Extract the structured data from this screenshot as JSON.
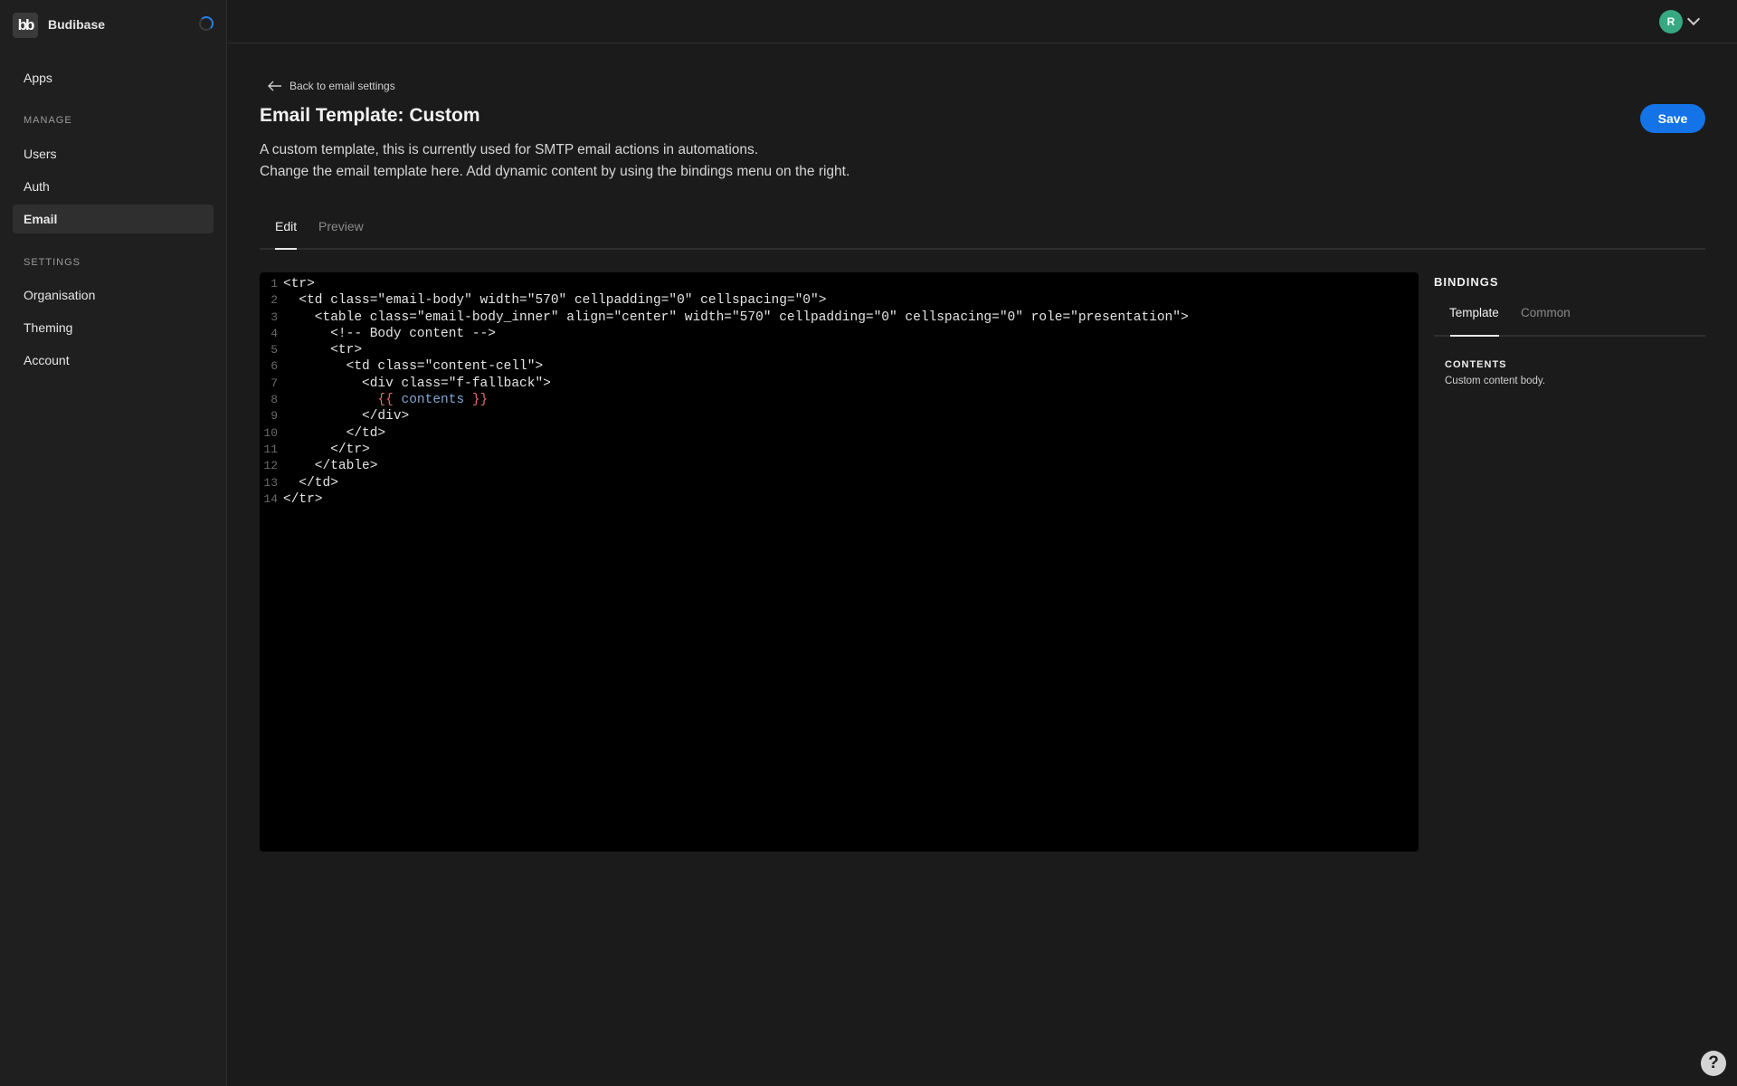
{
  "app": {
    "name": "Budibase",
    "logo_text": "bb"
  },
  "sidebar": {
    "apps": "Apps",
    "manage_heading": "MANAGE",
    "manage_items": [
      "Users",
      "Auth",
      "Email"
    ],
    "settings_heading": "SETTINGS",
    "settings_items": [
      "Organisation",
      "Theming",
      "Account"
    ],
    "active": "Email"
  },
  "user": {
    "initial": "R",
    "avatar_color": "#36a882"
  },
  "page": {
    "back_label": "Back to email settings",
    "title": "Email Template: Custom",
    "description": [
      "A custom template, this is currently used for SMTP email actions in automations.",
      "Change the email template here. Add dynamic content by using the bindings menu on the right."
    ],
    "save_label": "Save",
    "tabs": [
      "Edit",
      "Preview"
    ],
    "active_tab": "Edit"
  },
  "editor": {
    "lines": [
      [
        {
          "t": "<tr>"
        }
      ],
      [
        {
          "t": "  <td class=\"email-body\" width=\"570\" cellpadding=\"0\" cellspacing=\"0\">"
        }
      ],
      [
        {
          "t": "    <table class=\"email-body_inner\" align=\"center\" width=\"570\" cellpadding=\"0\" cellspacing=\"0\" role=\"presentation\">"
        }
      ],
      [
        {
          "t": "      <!-- Body content -->"
        }
      ],
      [
        {
          "t": "      <tr>"
        }
      ],
      [
        {
          "t": "        <td class=\"content-cell\">"
        }
      ],
      [
        {
          "t": "          <div class=\"f-fallback\">"
        }
      ],
      [
        {
          "t": "            "
        },
        {
          "t": "{{",
          "k": "brace"
        },
        {
          "t": " contents ",
          "k": "var"
        },
        {
          "t": "}}",
          "k": "brace"
        }
      ],
      [
        {
          "t": "          </div>"
        }
      ],
      [
        {
          "t": "        </td>"
        }
      ],
      [
        {
          "t": "      </tr>"
        }
      ],
      [
        {
          "t": "    </table>"
        }
      ],
      [
        {
          "t": "  </td>"
        }
      ],
      [
        {
          "t": "</tr>"
        }
      ]
    ]
  },
  "bindings": {
    "title": "BINDINGS",
    "tabs": [
      "Template",
      "Common"
    ],
    "active_tab": "Template",
    "items": [
      {
        "name": "CONTENTS",
        "description": "Custom content body."
      }
    ]
  },
  "help": {
    "icon": "help-icon",
    "glyph": "?"
  },
  "colors": {
    "accent": "#1473e6",
    "background": "#1b1b1b",
    "editor_bg": "#000000"
  }
}
